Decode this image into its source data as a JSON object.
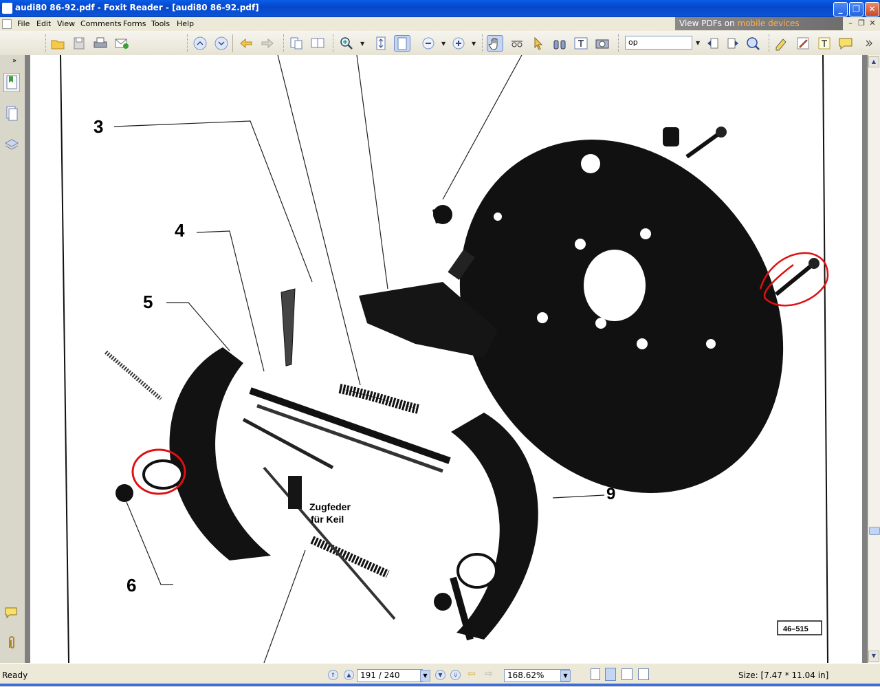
{
  "window": {
    "title": "audi80 86-92.pdf - Foxit Reader - [audi80 86-92.pdf]",
    "accent_color": "#0a54d8"
  },
  "menubar": {
    "items": [
      "File",
      "Edit",
      "View",
      "Comments",
      "Forms",
      "Tools",
      "Help"
    ],
    "ad_prefix": "View PDFs on ",
    "ad_highlight": "mobile devices"
  },
  "toolbar": {
    "find_value": "op"
  },
  "document": {
    "labels": {
      "l3": "3",
      "l4": "4",
      "l5": "5",
      "l6": "6",
      "l9": "9",
      "zugfeder1": "Zugfeder",
      "zugfeder2": "für Keil",
      "refno": "46–515"
    },
    "annotation_color": "#e01010"
  },
  "statusbar": {
    "status": "Ready",
    "page_field": "191 / 240",
    "zoom_field": "168.62%",
    "size_text": "Size: [7.47 * 11.04 in]"
  }
}
